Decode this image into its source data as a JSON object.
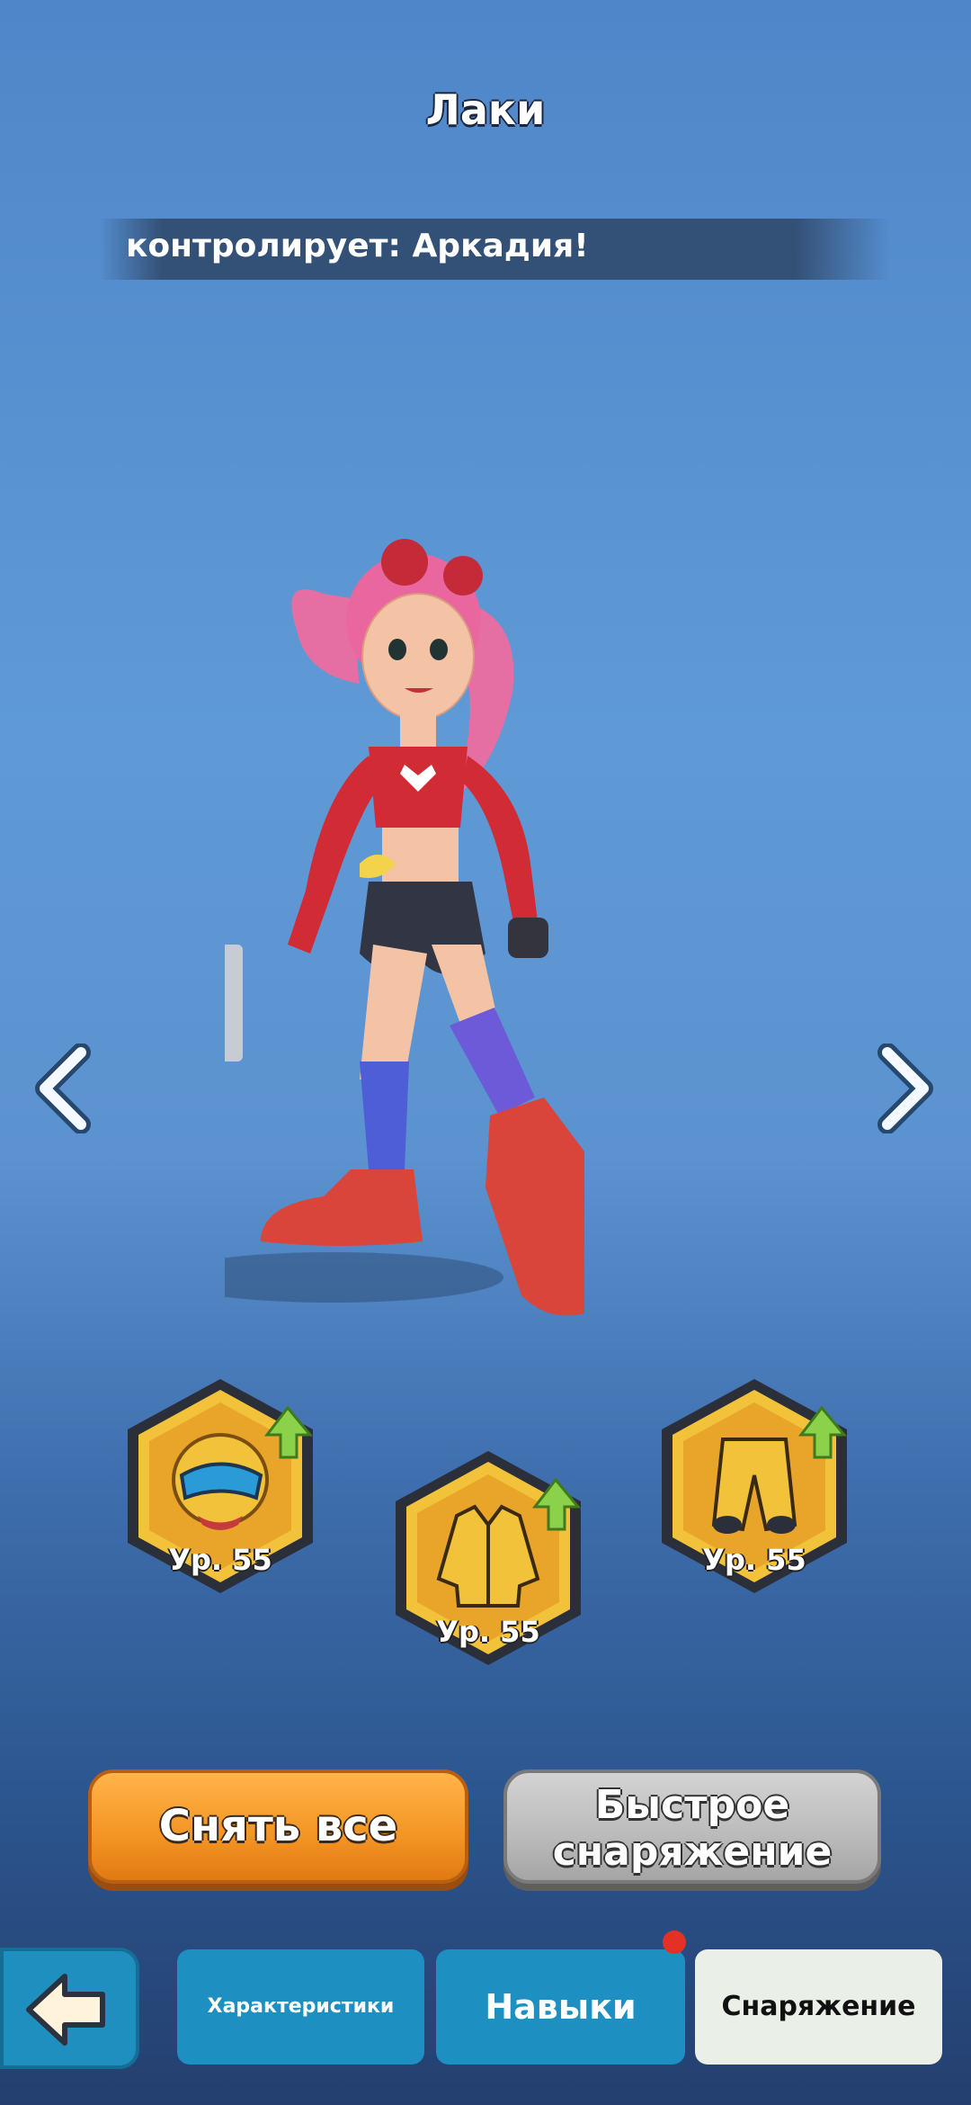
{
  "header": {
    "title": "Лаки",
    "banner_text": "контролирует: Аркадия!"
  },
  "navigation": {
    "prev_icon": "chevron-left-icon",
    "next_icon": "chevron-right-icon"
  },
  "gear": [
    {
      "slot": "helmet",
      "icon": "helmet-icon",
      "level_label": "Ур. 55",
      "upgrade_available": true
    },
    {
      "slot": "jacket",
      "icon": "jacket-icon",
      "level_label": "Ур. 55",
      "upgrade_available": true
    },
    {
      "slot": "pants",
      "icon": "pants-icon",
      "level_label": "Ур. 55",
      "upgrade_available": true
    }
  ],
  "actions": {
    "remove_all_label": "Снять все",
    "quick_equip_line1": "Быстрое",
    "quick_equip_line2": "снаряжение"
  },
  "tabs": {
    "back_icon": "back-arrow-icon",
    "characteristics_label": "Характеристики",
    "skills_label": "Навыки",
    "equipment_label": "Снаряжение",
    "skills_has_notification": true
  },
  "colors": {
    "accent_orange": "#f39423",
    "tab_blue": "#1d8fc0",
    "active_tab": "#eaf0e8",
    "gear_gold": "#f2c23a",
    "notification_red": "#e53125"
  }
}
